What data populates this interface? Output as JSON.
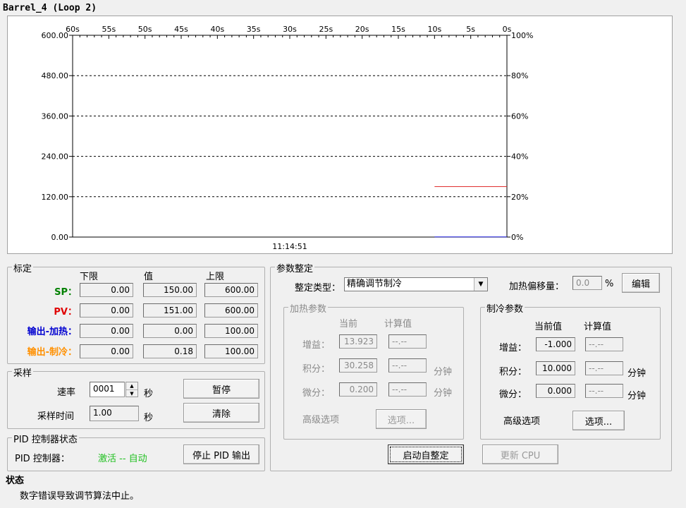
{
  "window": {
    "title": "Barrel_4 (Loop 2)"
  },
  "chart_data": {
    "type": "line",
    "x_ticks": [
      "60s",
      "55s",
      "50s",
      "45s",
      "40s",
      "35s",
      "30s",
      "25s",
      "20s",
      "15s",
      "10s",
      "5s",
      "0s"
    ],
    "y_left_ticks": [
      "600.00",
      "480.00",
      "360.00",
      "240.00",
      "120.00",
      "0.00"
    ],
    "y_right_ticks": [
      "100%",
      "80%",
      "60%",
      "40%",
      "20%",
      "0%"
    ],
    "ylim": [
      0,
      600
    ],
    "xlim": [
      60,
      0
    ],
    "time_label": "11:14:51",
    "grid": "dashed-horizontal",
    "series": [
      {
        "color": "#e03030",
        "x": [
          10,
          0
        ],
        "y": [
          150,
          150
        ]
      },
      {
        "color": "#2020e0",
        "x": [
          10,
          0
        ],
        "y": [
          0.5,
          0.5
        ]
      }
    ]
  },
  "calibration": {
    "legend": "标定",
    "headers": {
      "low": "下限",
      "value": "值",
      "high": "上限"
    },
    "rows": [
      {
        "label": "SP：",
        "color": "#008000",
        "low": "0.00",
        "value": "150.00",
        "high": "600.00"
      },
      {
        "label": "PV：",
        "color": "#e00000",
        "low": "0.00",
        "value": "151.00",
        "high": "600.00"
      },
      {
        "label": "输出-加热：",
        "color": "#0000d0",
        "low": "0.00",
        "value": "0.00",
        "high": "100.00"
      },
      {
        "label": "输出-制冷：",
        "color": "#ff9000",
        "low": "0.00",
        "value": "0.18",
        "high": "100.00"
      }
    ]
  },
  "sampling": {
    "legend": "采样",
    "rate_label": "速率",
    "rate_value": "0001",
    "rate_unit": "秒",
    "time_label": "采样时间",
    "time_value": "1.00",
    "time_unit": "秒",
    "pause_label": "暂停",
    "clear_label": "清除"
  },
  "pid_state": {
    "legend": "PID 控制器状态",
    "label": "PID 控制器：",
    "value": "激活 -- 自动",
    "value_color": "#20c020",
    "stop_label": "停止 PID 输出"
  },
  "tuning": {
    "legend": "参数整定",
    "type_label": "整定类型：",
    "type_value": "精确调节制冷",
    "offset_label": "加热偏移量：",
    "offset_value": "0.0",
    "offset_unit": "%",
    "edit_label": "编辑",
    "start_label": "启动自整定",
    "update_label": "更新 CPU"
  },
  "heating": {
    "legend": "加热参数",
    "col_current": "当前",
    "col_calc": "计算值",
    "gain_label": "增益：",
    "gain_value": "13.923",
    "gain_calc": "--.--",
    "integral_label": "积分：",
    "integral_value": "30.258",
    "integral_calc": "--.--",
    "integral_unit": "分钟",
    "derivative_label": "微分：",
    "derivative_value": "0.200",
    "derivative_calc": "--.--",
    "derivative_unit": "分钟",
    "advanced_label": "高级选项",
    "options_label": "选项..."
  },
  "cooling": {
    "legend": "制冷参数",
    "col_current": "当前值",
    "col_calc": "计算值",
    "gain_label": "增益：",
    "gain_value": "-1.000",
    "gain_calc": "--.--",
    "integral_label": "积分：",
    "integral_value": "10.000",
    "integral_calc": "--.--",
    "integral_unit": "分钟",
    "derivative_label": "微分：",
    "derivative_value": "0.000",
    "derivative_calc": "--.--",
    "derivative_unit": "分钟",
    "advanced_label": "高级选项",
    "options_label": "选项..."
  },
  "status": {
    "title": "状态",
    "message": "数字错误导致调节算法中止。"
  }
}
